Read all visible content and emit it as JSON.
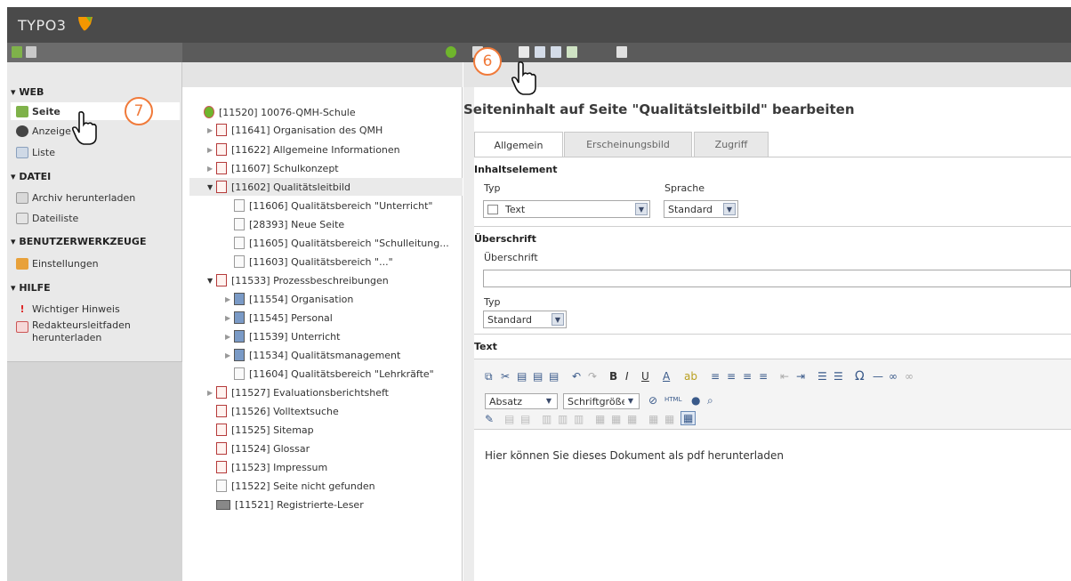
{
  "app": {
    "logo_text": "TYPO3",
    "accent": "#f49700"
  },
  "sidebar": {
    "groups": [
      {
        "label": "▾ WEB"
      },
      {
        "label": "▾ DATEI"
      },
      {
        "label": "▾ BENUTZERWERKZEUGE"
      },
      {
        "label": "▾ HILFE"
      }
    ],
    "items": [
      {
        "label": "Seite",
        "icon": "page-icon"
      },
      {
        "label": "Anzeige",
        "icon": "eye-icon"
      },
      {
        "label": "Liste",
        "icon": "list-icon"
      },
      {
        "label": "Archiv herunterladen",
        "icon": "archive-icon"
      },
      {
        "label": "Dateiliste",
        "icon": "folder-icon"
      },
      {
        "label": "Einstellungen",
        "icon": "user-settings-icon"
      },
      {
        "label": "Wichtiger Hinweis",
        "icon": "exclamation-icon"
      },
      {
        "label": "Redakteursleitfaden",
        "icon": "pdf-icon"
      },
      {
        "label": "herunterladen"
      }
    ]
  },
  "tree": {
    "nodes": [
      {
        "label": "[11520] 10076-QMH-Schule"
      },
      {
        "label": "[11641] Organisation des QMH"
      },
      {
        "label": "[11622] Allgemeine Informationen"
      },
      {
        "label": "[11607] Schulkonzept"
      },
      {
        "label": "[11602] Qualitätsleitbild"
      },
      {
        "label": "[11606] Qualitätsbereich \"Unterricht\""
      },
      {
        "label": "[28393] Neue Seite"
      },
      {
        "label": "[11605] Qualitätsbereich \"Schulleitung..."
      },
      {
        "label": "[11603] Qualitätsbereich \"...\""
      },
      {
        "label": "[11533] Prozessbeschreibungen"
      },
      {
        "label": "[11554] Organisation"
      },
      {
        "label": "[11545] Personal"
      },
      {
        "label": "[11539] Unterricht"
      },
      {
        "label": "[11534] Qualitätsmanagement"
      },
      {
        "label": "[11604] Qualitätsbereich \"Lehrkräfte\""
      },
      {
        "label": "[11527] Evaluationsberichtsheft"
      },
      {
        "label": "[11526] Volltextsuche"
      },
      {
        "label": "[11525] Sitemap"
      },
      {
        "label": "[11524] Glossar"
      },
      {
        "label": "[11523] Impressum"
      },
      {
        "label": "[11522] Seite nicht gefunden"
      },
      {
        "label": "[11521] Registrierte-Leser"
      }
    ]
  },
  "content": {
    "title": "Seiteninhalt auf Seite \"Qualitätsleitbild\" bearbeiten",
    "tabs": [
      {
        "label": "Allgemein"
      },
      {
        "label": "Erscheinungsbild"
      },
      {
        "label": "Zugriff"
      }
    ],
    "inhaltselement": "Inhaltselement",
    "typ_label": "Typ",
    "typ_value": "Text",
    "sprache_label": "Sprache",
    "sprache_value": "Standard",
    "ueberschrift_section": "Überschrift",
    "ueberschrift_label": "Überschrift",
    "ueberschrift_value": "",
    "typ2_label": "Typ",
    "typ2_value": "Standard",
    "text_section": "Text",
    "rte": {
      "format_value": "Absatz",
      "size_value": "Schriftgröße",
      "body": "Hier können Sie dieses Dokument als pdf herunterladen"
    }
  },
  "callouts": {
    "six": "6",
    "seven": "7"
  }
}
